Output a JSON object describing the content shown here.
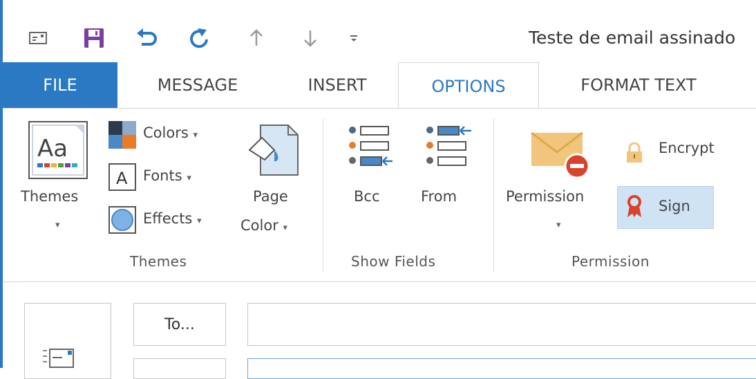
{
  "window": {
    "title": "Teste de email assinado"
  },
  "quick_access": {
    "icons": [
      "mail-window-icon",
      "save-icon",
      "undo-icon",
      "redo-icon",
      "up-arrow-icon",
      "down-arrow-icon",
      "customize-qat-icon"
    ]
  },
  "tabs": [
    {
      "label": "FILE",
      "state": "file"
    },
    {
      "label": "MESSAGE",
      "state": "normal"
    },
    {
      "label": "INSERT",
      "state": "normal"
    },
    {
      "label": "OPTIONS",
      "state": "active"
    },
    {
      "label": "FORMAT TEXT",
      "state": "normal"
    }
  ],
  "ribbon": {
    "themes_group": {
      "label": "Themes",
      "themes_button": "Themes",
      "colors_button": "Colors",
      "fonts_button": "Fonts",
      "effects_button": "Effects",
      "page_color_line1": "Page",
      "page_color_line2": "Color"
    },
    "show_fields_group": {
      "label": "Show Fields",
      "bcc_button": "Bcc",
      "from_button": "From"
    },
    "permission_group": {
      "label": "Permission",
      "permission_button": "Permission",
      "encrypt_button": "Encrypt",
      "sign_button": "Sign"
    }
  },
  "compose": {
    "to_button": "To...",
    "to_value": "",
    "cc_value": ""
  },
  "colors": {
    "accent": "#2b79c2",
    "save_purple": "#7b3fa0",
    "sign_highlight": "#cfe3f4",
    "envelope": "#f1c67c",
    "no_entry_red": "#d9432b"
  }
}
